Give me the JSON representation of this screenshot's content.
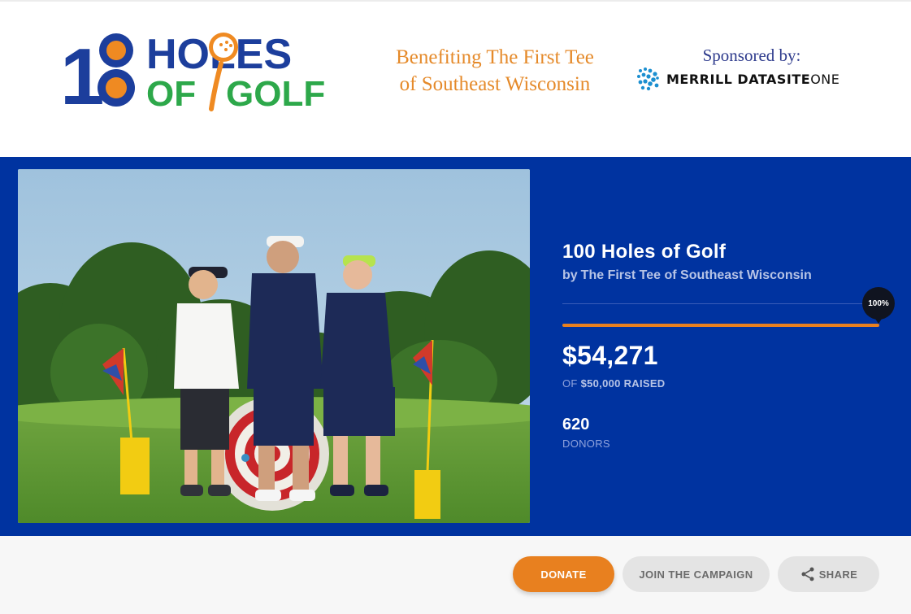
{
  "header": {
    "logo": {
      "number_one": "1",
      "number_eight": "8",
      "word_holes": "HOLES",
      "word_of": "OF",
      "word_golf": "GOLF"
    },
    "benefit_line1": "Benefiting The First Tee",
    "benefit_line2": "of Southeast Wisconsin",
    "sponsor_label": "Sponsored by:",
    "sponsor_name": "MERRILL DATASITE",
    "sponsor_name_suffix": "ONE"
  },
  "campaign": {
    "title": "100 Holes of Golf",
    "by_label": "by",
    "organization": "The First Tee of Southeast Wisconsin",
    "raised": "$54,271",
    "goal_prefix": "OF",
    "goal_amount": "$50,000 RAISED",
    "progress_label": "100%",
    "progress_fraction": 1.0,
    "donors_count": "620",
    "donors_label": "DONORS"
  },
  "actions": {
    "donate": "DONATE",
    "join": "JOIN THE CAMPAIGN",
    "share": "SHARE"
  },
  "icons": [
    "share-icon"
  ],
  "colors": {
    "hero_bg": "#0033a0",
    "accent_orange": "#e8801f",
    "logo_blue": "#1c3e9c",
    "logo_green": "#2da84a"
  }
}
